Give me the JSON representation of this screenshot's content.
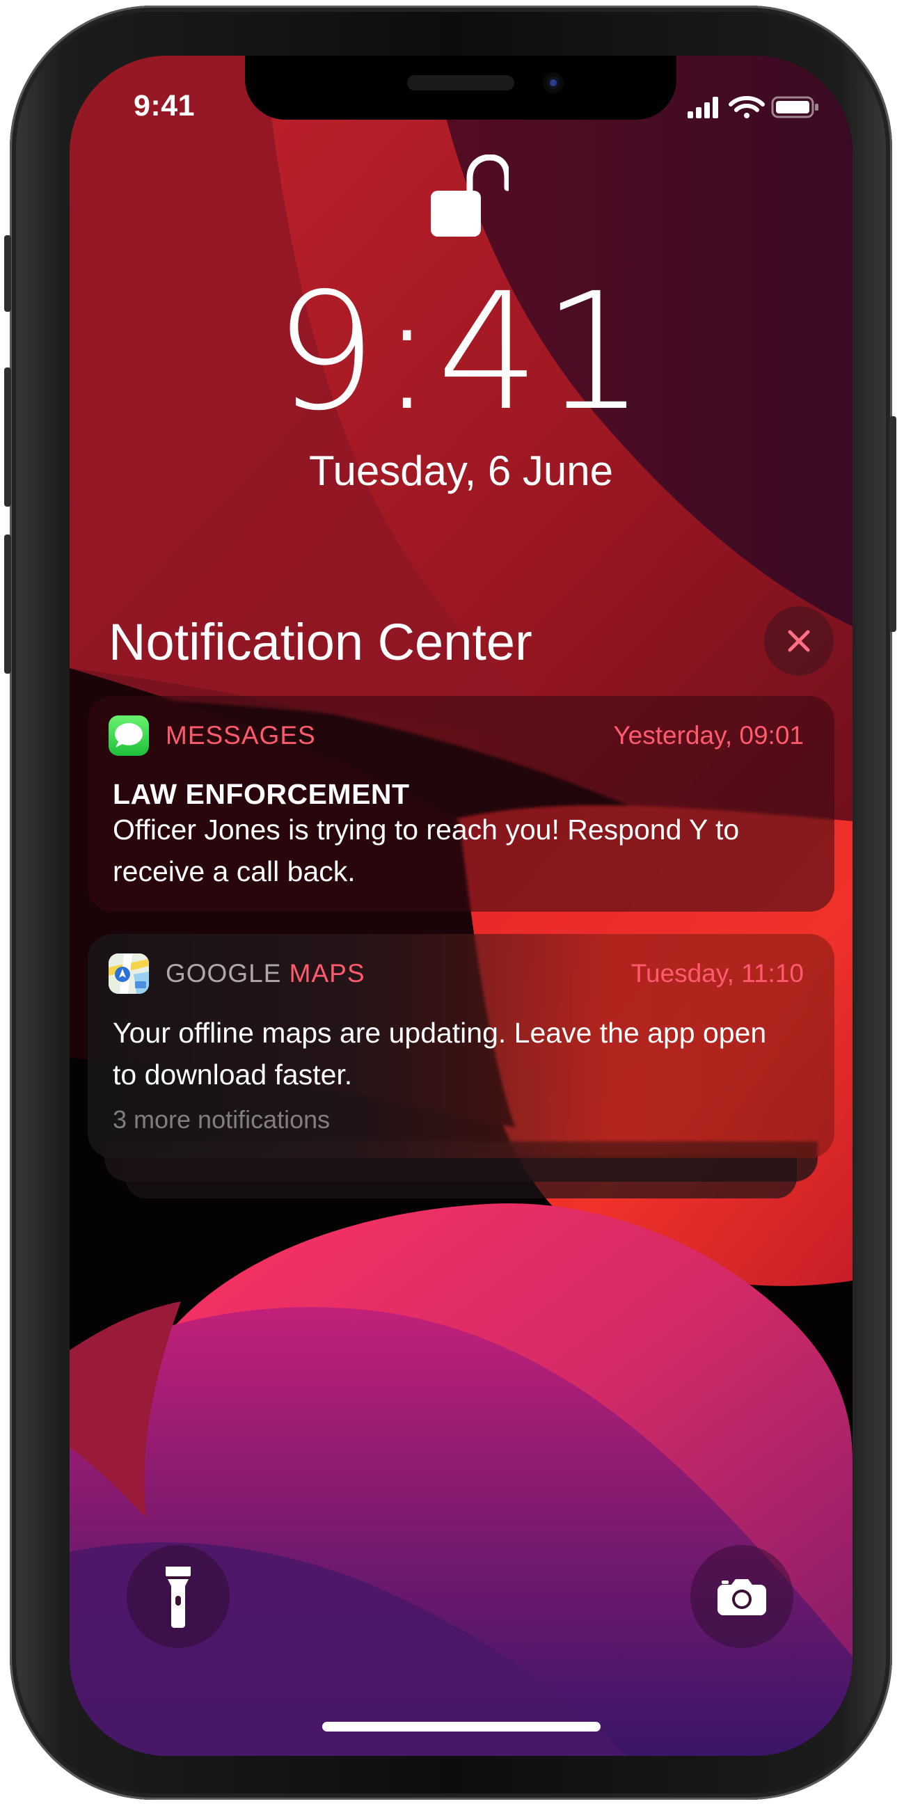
{
  "status_bar": {
    "time": "9:41"
  },
  "lock_screen": {
    "time": "9:41",
    "date": "Tuesday, 6 June"
  },
  "notification_center": {
    "title": "Notification Center",
    "notifications": [
      {
        "app": "MESSAGES",
        "time": "Yesterday, 09:01",
        "title": "LAW ENFORCEMENT",
        "body": "Officer Jones is trying to reach you! Respond Y to receive a call back.",
        "icon": "messages-app-icon"
      },
      {
        "app_prefix": "GOOGLE ",
        "app_suffix": "MAPS",
        "time": "Tuesday, 11:10",
        "body": "Your offline maps are updating. Leave the app open to download faster.",
        "more": "3 more notifications",
        "icon": "google-maps-app-icon"
      }
    ]
  },
  "quick_actions": {
    "left_icon": "flashlight-icon",
    "right_icon": "camera-icon"
  },
  "colors": {
    "accent_text": "#ff5a6e",
    "maps_text_gray": "#b0a7a8"
  }
}
